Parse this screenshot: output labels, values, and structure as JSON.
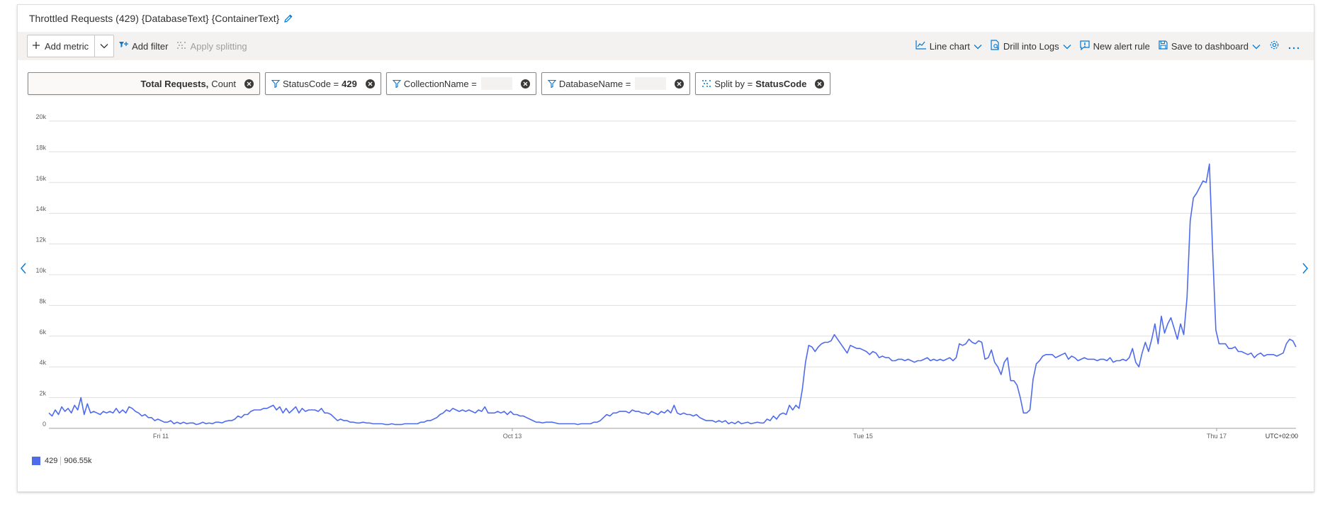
{
  "title": "Throttled Requests (429) {DatabaseText} {ContainerText}",
  "toolbar": {
    "add_metric": "Add metric",
    "add_filter": "Add filter",
    "apply_splitting": "Apply splitting",
    "chart_type": "Line chart",
    "drill_logs": "Drill into Logs",
    "new_alert": "New alert rule",
    "save_dashboard": "Save to dashboard"
  },
  "pills": {
    "metric_name": "Total Requests,",
    "metric_agg": "Count",
    "status_label": "StatusCode =",
    "status_value": "429",
    "collection_label": "CollectionName =",
    "database_label": "DatabaseName =",
    "split_label": "Split by =",
    "split_value": "StatusCode"
  },
  "colors": {
    "line": "#4f6bed",
    "accent": "#0078d4"
  },
  "legend": {
    "name": "429",
    "total": "906.55k"
  },
  "chart_data": {
    "type": "line",
    "title": "",
    "xlabel": "",
    "ylabel": "",
    "ylim": [
      0,
      20000
    ],
    "yticks": [
      "0",
      "2k",
      "4k",
      "6k",
      "8k",
      "10k",
      "12k",
      "14k",
      "16k",
      "18k",
      "20k"
    ],
    "xticks": [
      "Fri 11",
      "Oct 13",
      "Tue 15",
      "Thu 17"
    ],
    "timezone": "UTC+02:00",
    "grid": true,
    "series": [
      {
        "name": "429",
        "values": [
          1000,
          800,
          1200,
          900,
          1400,
          1100,
          1300,
          1000,
          1500,
          1200,
          2000,
          900,
          1600,
          1000,
          1100,
          1000,
          900,
          1100,
          1000,
          1100,
          1000,
          1300,
          1000,
          1200,
          1000,
          1400,
          1300,
          1100,
          1000,
          800,
          900,
          700,
          700,
          500,
          600,
          500,
          400,
          400,
          500,
          300,
          400,
          300,
          400,
          300,
          350,
          350,
          250,
          300,
          400,
          300,
          350,
          300,
          400,
          400,
          350,
          450,
          500,
          500,
          600,
          800,
          700,
          900,
          900,
          1100,
          1200,
          1200,
          1200,
          1300,
          1300,
          1400,
          1500,
          1200,
          1400,
          1000,
          1300,
          1000,
          1200,
          1400,
          1000,
          1300,
          1100,
          1200,
          1200,
          1200,
          1100,
          1300,
          1000,
          1000,
          900,
          700,
          500,
          600,
          500,
          500,
          400,
          400,
          350,
          350,
          400,
          350,
          350,
          300,
          300,
          300,
          300,
          250,
          250,
          300,
          250,
          250,
          250,
          300,
          300,
          300,
          300,
          300,
          400,
          400,
          500,
          500,
          600,
          700,
          900,
          1000,
          1200,
          1100,
          1300,
          1200,
          1100,
          1200,
          1100,
          1200,
          1100,
          1000,
          1200,
          1100,
          1400,
          1000,
          1000,
          1000,
          1100,
          1000,
          1100,
          900,
          1100,
          900,
          900,
          800,
          800,
          700,
          600,
          500,
          400,
          400,
          350,
          400,
          400,
          400,
          350,
          300,
          300,
          300,
          300,
          300,
          300,
          250,
          300,
          300,
          300,
          300,
          400,
          400,
          500,
          700,
          900,
          800,
          1000,
          1000,
          1100,
          1100,
          1100,
          1000,
          1200,
          1100,
          1100,
          1000,
          1000,
          900,
          1100,
          1000,
          900,
          1100,
          1000,
          1200,
          1000,
          1500,
          1000,
          900,
          1000,
          900,
          900,
          800,
          900,
          700,
          600,
          500,
          500,
          500,
          400,
          500,
          400,
          500,
          300,
          400,
          300,
          450,
          300,
          350,
          400,
          300,
          350,
          400,
          350,
          350,
          600,
          500,
          800,
          600,
          900,
          1000,
          900,
          1500,
          1200,
          1500,
          1300,
          2500,
          4300,
          5400,
          5300,
          5000,
          5300,
          5500,
          5600,
          5600,
          5700,
          6100,
          5800,
          5500,
          5200,
          4900,
          5400,
          5300,
          5200,
          5200,
          5100,
          5000,
          4800,
          5000,
          4900,
          4600,
          4700,
          4600,
          4600,
          4400,
          4400,
          4500,
          4500,
          4400,
          4500,
          4400,
          4300,
          4400,
          4400,
          4500,
          4600,
          4400,
          4500,
          4400,
          4500,
          4400,
          4500,
          4600,
          4400,
          4600,
          5500,
          5400,
          5500,
          5800,
          5600,
          5500,
          5700,
          5600,
          4500,
          4600,
          5100,
          4300,
          4000,
          3500,
          4300,
          4600,
          3100,
          3100,
          2800,
          2000,
          1000,
          1000,
          1200,
          3200,
          4200,
          4400,
          4700,
          4800,
          4800,
          4800,
          4600,
          4700,
          4800,
          4900,
          4500,
          4700,
          4600,
          4400,
          4500,
          4600,
          4500,
          4500,
          4500,
          4400,
          4500,
          4500,
          4400,
          4600,
          4300,
          4400,
          4400,
          4500,
          4400,
          4600,
          5200,
          4300,
          4000,
          4900,
          5600,
          5000,
          5800,
          6800,
          5500,
          7300,
          6200,
          6800,
          7200,
          6500,
          5800,
          6800,
          6100,
          8500,
          13500,
          15000,
          15300,
          15700,
          16100,
          16000,
          17200,
          11500,
          6400,
          5500,
          5500,
          5500,
          5200,
          5200,
          5300,
          5000,
          5000,
          4900,
          4800,
          4900,
          4600,
          4800,
          4900,
          4700,
          4800,
          4800,
          4800,
          4700,
          4800,
          4900,
          5500,
          5800,
          5700,
          5300
        ]
      }
    ]
  }
}
